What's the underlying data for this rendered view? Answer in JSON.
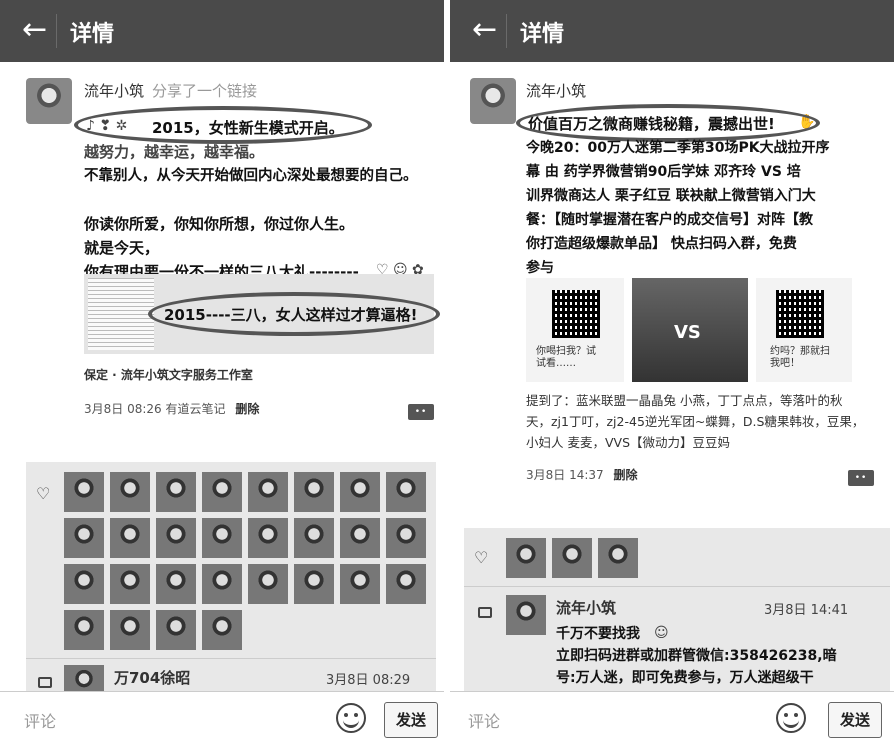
{
  "header": {
    "back_glyph": "←",
    "title": "详情"
  },
  "left": {
    "username": "流年小筑",
    "share_text": "分享了一个链接",
    "lines": [
      "2015，女性新生模式开启。",
      "越努力，越幸运，越幸福。",
      "不靠别人，从今天开始做回内心深处最想要的自己。",
      "你读你所爱，你知你所想，你过你人生。",
      "就是今天，",
      "你有理由要一份不一样的三八大礼--------"
    ],
    "link_title": "2015----三八，女人这样过才算逼格!",
    "source": "保定 · 流年小筑文字服务工作室",
    "time": "3月8日 08:26",
    "via": "有道云笔记",
    "delete": "删除",
    "comment": {
      "name": "万704徐昭",
      "time": "3月8日 08:29"
    }
  },
  "right": {
    "username": "流年小筑",
    "highlight": "价值百万之微商赚钱秘籍，震撼出世!",
    "lines": [
      "今晚20：00万人迷第二季第30场PK大战拉开序",
      "幕 由 药学界微营销90后学妹 邓齐玲 VS 培",
      "训界微商达人 栗子红豆 联袂献上微营销入门大",
      "餐：【随时掌握潜在客户的成交信号】对阵【教",
      "你打造超级爆款单品】 快点扫码入群，免费",
      "参与"
    ],
    "poster": {
      "left_bubble": "你喝扫我？试试看……",
      "vs": "VS",
      "right_bubble": "约吗？那就扫我吧！"
    },
    "mentions": [
      "提到了：蓝米联盟一晶晶兔 小燕，丁丁点点，等落叶的秋",
      "天，zj1丁叮，zj2-45逆光军团~蝶舞，D.S糖果韩妆，豆果，",
      "小妇人 麦麦，VVS【微动力】豆豆妈"
    ],
    "time": "3月8日 14:37",
    "delete": "删除",
    "comment": {
      "name": "流年小筑",
      "time": "3月8日 14:41",
      "lines": [
        "千万不要找我",
        "立即扫码进群或加群管微信:358426238,暗",
        "号:万人迷，即可免费参与，万人迷超级干"
      ]
    }
  },
  "input": {
    "placeholder": "评论",
    "send_label": "发送"
  }
}
